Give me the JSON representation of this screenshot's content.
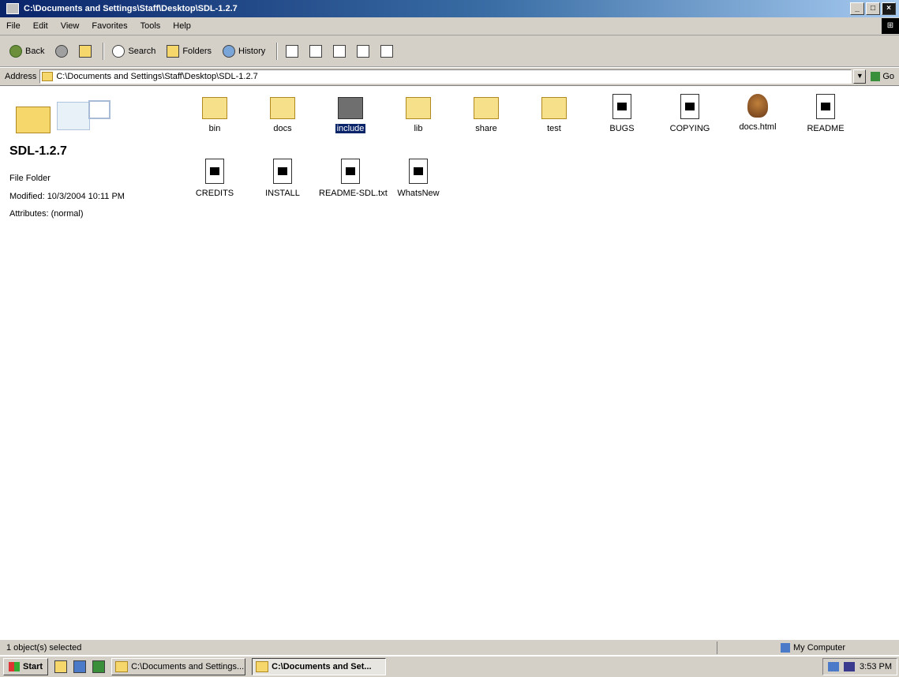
{
  "window": {
    "title": "C:\\Documents and Settings\\Staff\\Desktop\\SDL-1.2.7",
    "buttons": {
      "minimize": "_",
      "maximize": "□",
      "close": "×"
    }
  },
  "menubar": {
    "items": [
      "File",
      "Edit",
      "View",
      "Favorites",
      "Tools",
      "Help"
    ]
  },
  "toolbar": {
    "back": "Back",
    "forward": "",
    "up": "",
    "search": "Search",
    "folders": "Folders",
    "history": "History"
  },
  "address": {
    "label": "Address",
    "value": "C:\\Documents and Settings\\Staff\\Desktop\\SDL-1.2.7",
    "go": "Go"
  },
  "leftpane": {
    "folder_name": "SDL-1.2.7",
    "info_type": "File Folder",
    "modified": "Modified: 10/3/2004 10:11 PM",
    "attributes": "Attributes: (normal)"
  },
  "files": [
    {
      "label": "bin",
      "type": "folder",
      "selected": false
    },
    {
      "label": "docs",
      "type": "folder",
      "selected": false
    },
    {
      "label": "include",
      "type": "folder",
      "selected": true
    },
    {
      "label": "lib",
      "type": "folder",
      "selected": false
    },
    {
      "label": "share",
      "type": "folder",
      "selected": false
    },
    {
      "label": "test",
      "type": "folder",
      "selected": false
    },
    {
      "label": "BUGS",
      "type": "file",
      "selected": false
    },
    {
      "label": "COPYING",
      "type": "file",
      "selected": false
    },
    {
      "label": "docs.html",
      "type": "image",
      "selected": false
    },
    {
      "label": "README",
      "type": "file",
      "selected": false
    },
    {
      "label": "CREDITS",
      "type": "file",
      "selected": false
    },
    {
      "label": "INSTALL",
      "type": "file",
      "selected": false
    },
    {
      "label": "README-SDL.txt",
      "type": "file",
      "selected": false
    },
    {
      "label": "WhatsNew",
      "type": "file",
      "selected": false
    }
  ],
  "statusbar": {
    "text": "1 object(s) selected",
    "zone": "My Computer"
  },
  "taskbar": {
    "start": "Start",
    "tasks": [
      "C:\\Documents and Settings...",
      "C:\\Documents and Set..."
    ],
    "clock": "3:53 PM"
  },
  "colors": {
    "titlebar": "#0a246a",
    "selection": "#0a246a",
    "chrome": "#d4d0c8"
  }
}
